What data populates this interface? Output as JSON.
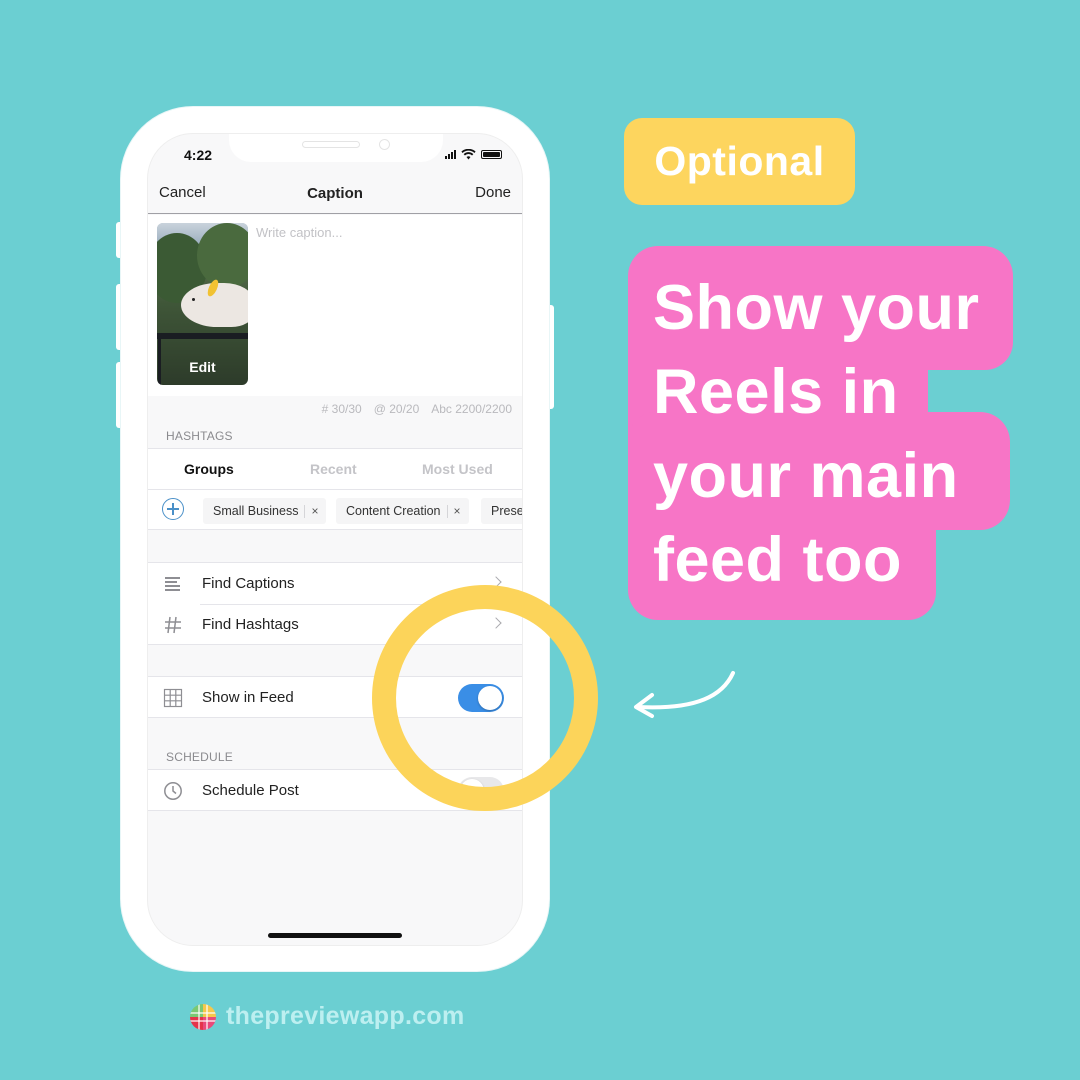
{
  "colors": {
    "background": "#6bcfd2",
    "optional_badge": "#fdd55e",
    "headline_bg": "#f775c6",
    "highlight_ring": "#fcd45a",
    "toggle_on": "#3a8ee6"
  },
  "status_bar": {
    "time": "4:22",
    "icons": [
      "signal-icon",
      "wifi-icon",
      "battery-icon"
    ]
  },
  "nav": {
    "cancel": "Cancel",
    "title": "Caption",
    "done": "Done"
  },
  "caption": {
    "thumbnail_edit_label": "Edit",
    "placeholder": "Write caption...",
    "value": ""
  },
  "counters": {
    "hashtags": "# 30/30",
    "mentions": "@ 20/20",
    "characters": "Abc 2200/2200"
  },
  "hashtags": {
    "section_label": "HASHTAGS",
    "tabs": [
      {
        "label": "Groups",
        "active": true
      },
      {
        "label": "Recent",
        "active": false
      },
      {
        "label": "Most Used",
        "active": false
      }
    ],
    "groups": [
      {
        "label": "Small Business",
        "remove": "×"
      },
      {
        "label": "Content Creation",
        "remove": "×"
      },
      {
        "label": "Prese"
      }
    ]
  },
  "find": {
    "items": [
      {
        "label": "Find Captions",
        "icon": "text-lines-icon"
      },
      {
        "label": "Find Hashtags",
        "icon": "hashtag-icon"
      }
    ]
  },
  "feed": {
    "label": "Show in Feed",
    "icon": "grid-icon",
    "enabled": true
  },
  "schedule": {
    "section_label": "SCHEDULE",
    "label": "Schedule Post",
    "icon": "clock-icon",
    "enabled": false
  },
  "callouts": {
    "optional": "Optional",
    "headline_lines": [
      "Show your",
      "Reels in",
      "your main",
      "feed too"
    ]
  },
  "footer": {
    "site": "thepreviewapp.com"
  }
}
